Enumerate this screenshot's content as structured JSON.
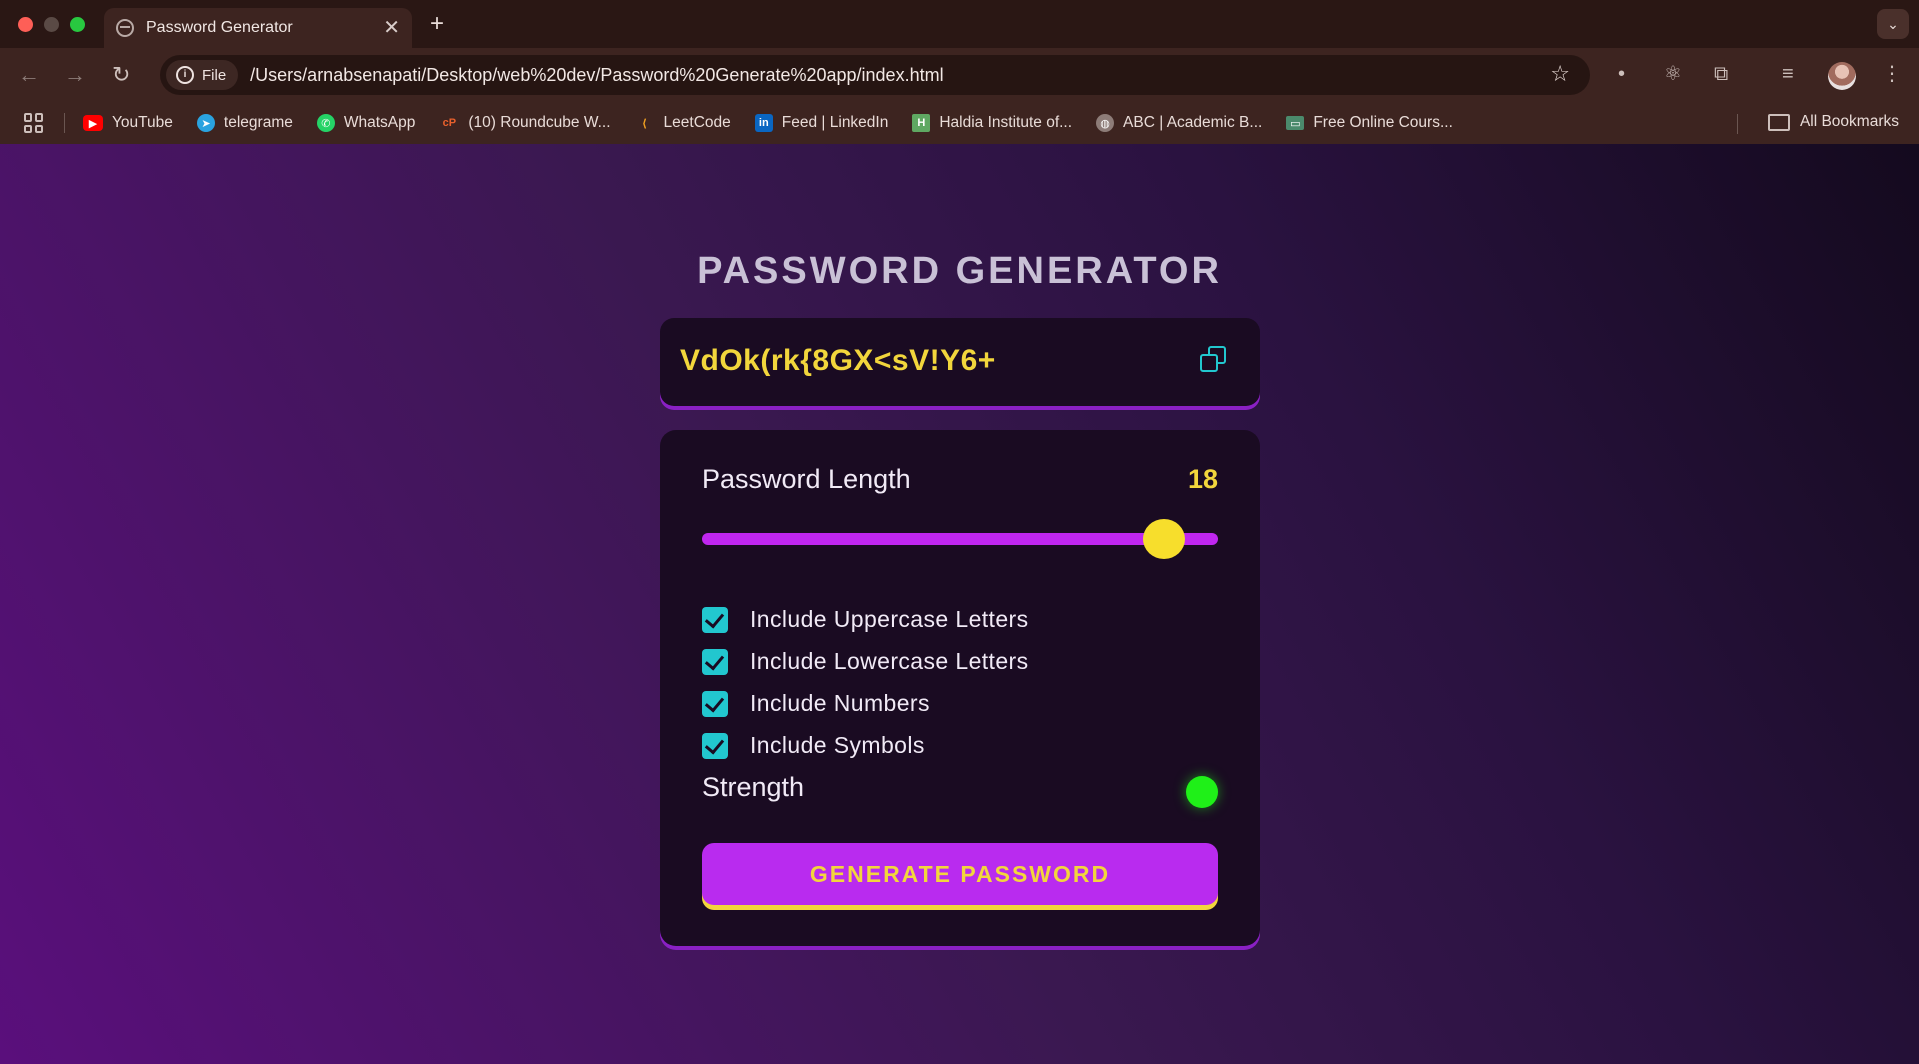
{
  "browser": {
    "tab": {
      "title": "Password Generator",
      "close": "✕"
    },
    "new_tab": "+",
    "tab_menu": "⌄",
    "nav": {
      "back": "←",
      "forward": "→",
      "reload": "↻"
    },
    "omnibox": {
      "chip": "File",
      "url": "/Users/arnabsenapati/Desktop/web%20dev/Password%20Generate%20app/index.html"
    },
    "star": "☆",
    "extensions": [
      "•",
      "⚛",
      "⧉",
      "≡"
    ],
    "bookmarks": [
      {
        "label": "YouTube",
        "icon": "youtube-icon",
        "color": "#ff0000",
        "glyph": "▶"
      },
      {
        "label": "telegrame",
        "icon": "telegram-icon",
        "color": "#2aa3e0",
        "glyph": "➤"
      },
      {
        "label": "WhatsApp",
        "icon": "whatsapp-icon",
        "color": "#25d366",
        "glyph": "✆"
      },
      {
        "label": "(10) Roundcube W...",
        "icon": "roundcube-icon",
        "color": "#e8602c",
        "glyph": "cP"
      },
      {
        "label": "LeetCode",
        "icon": "leetcode-icon",
        "color": "#3d2420",
        "glyph": "⟨"
      },
      {
        "label": "Feed | LinkedIn",
        "icon": "linkedin-icon",
        "color": "#0a66c2",
        "glyph": "in"
      },
      {
        "label": "Haldia Institute of...",
        "icon": "haldia-icon",
        "color": "#5fa862",
        "glyph": "H"
      },
      {
        "label": "ABC | Academic B...",
        "icon": "globe-icon",
        "color": "#8d7c78",
        "glyph": "◍"
      },
      {
        "label": "Free Online Cours...",
        "icon": "course-icon",
        "color": "#4b8a6c",
        "glyph": "▭"
      }
    ],
    "all_bookmarks": "All Bookmarks"
  },
  "app": {
    "title": "PASSWORD GENERATOR",
    "password": "VdOk(rk{8GX<sV!Y6+",
    "length_label": "Password Length",
    "length_value": "18",
    "slider": {
      "min": 1,
      "max": 20,
      "value": 18
    },
    "options": [
      {
        "label": "Include Uppercase Letters",
        "checked": true
      },
      {
        "label": "Include Lowercase Letters",
        "checked": true
      },
      {
        "label": "Include Numbers",
        "checked": true
      },
      {
        "label": "Include Symbols",
        "checked": true
      }
    ],
    "strength_label": "Strength",
    "strength_color": "#1ff018",
    "generate_label": "GENERATE PASSWORD",
    "colors": {
      "accent": "#c026f0",
      "yellow": "#f2d63c",
      "teal": "#22c7cf"
    }
  }
}
